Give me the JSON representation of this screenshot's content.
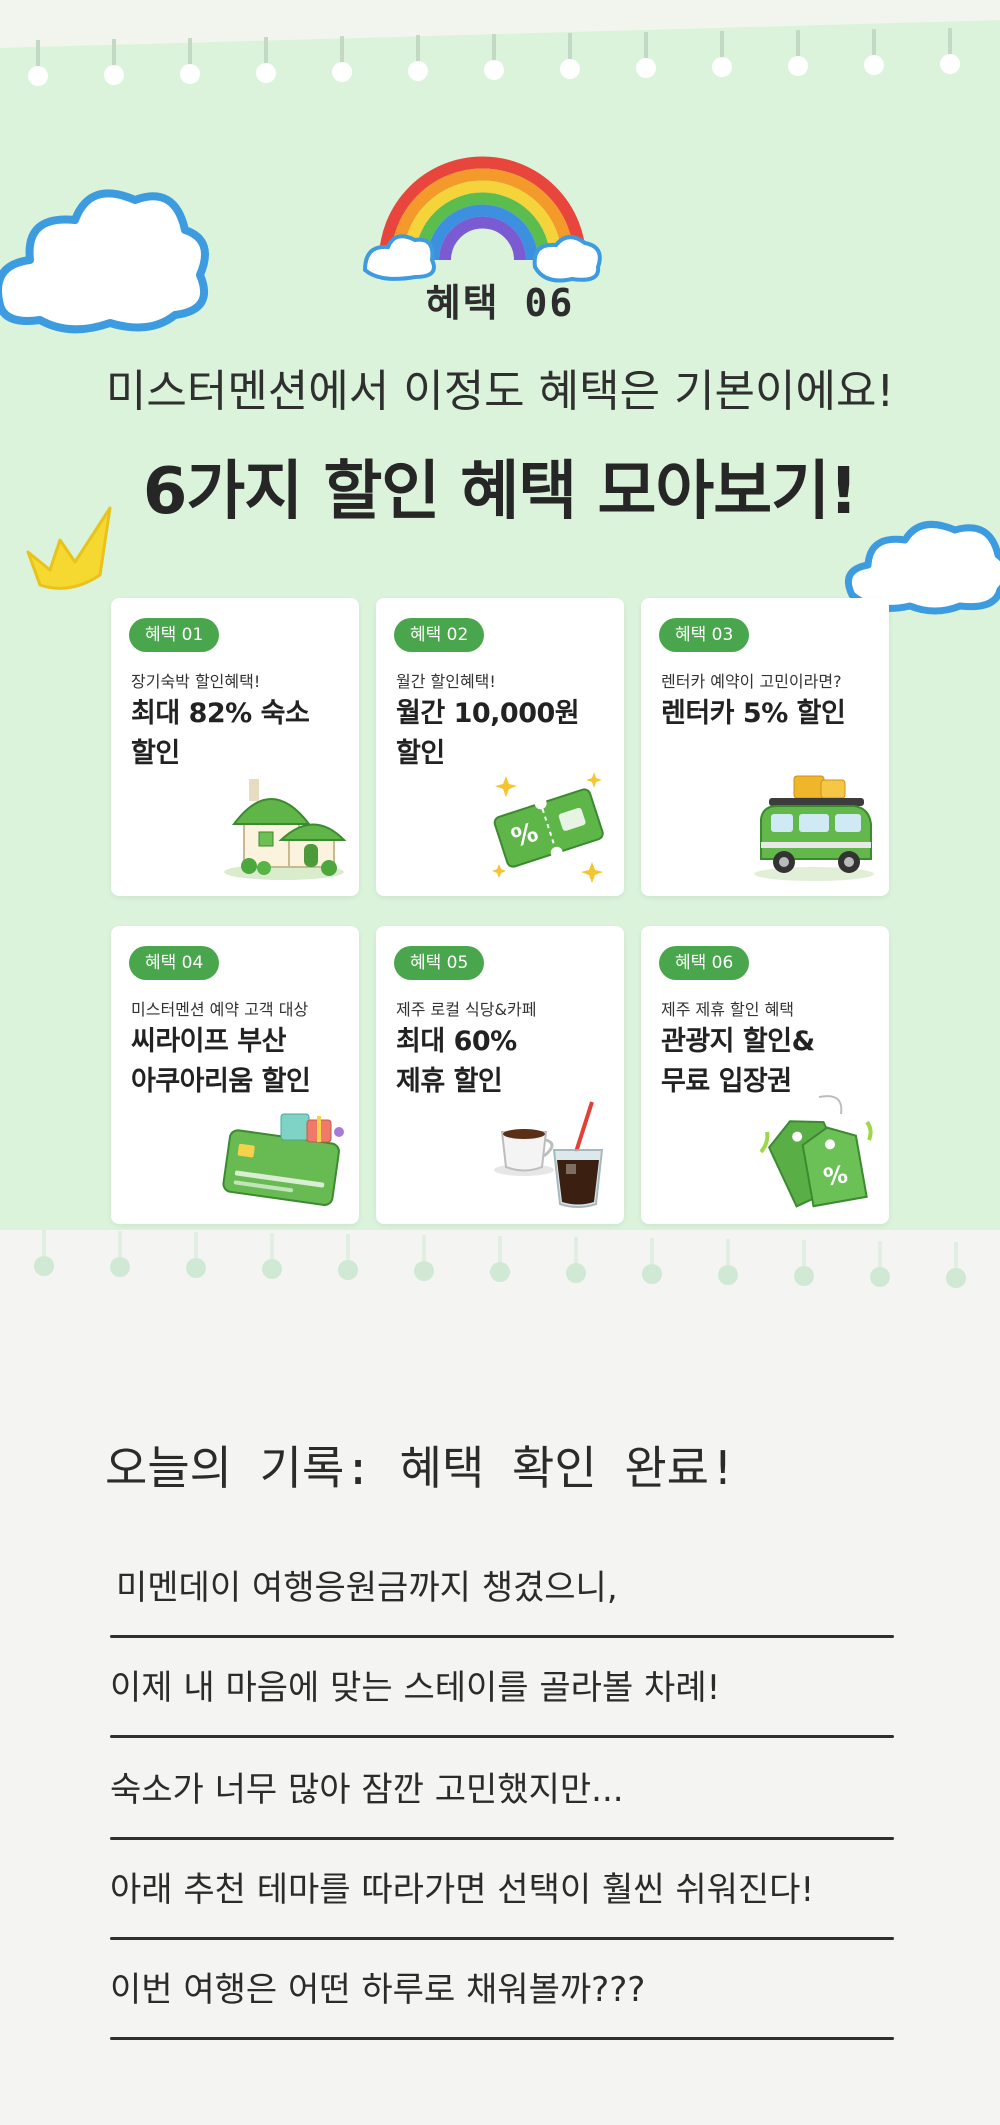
{
  "header": {
    "badge": "혜택 06",
    "subtitle": "미스터멘션에서 이정도 혜택은 기본이에요!",
    "headline": "6가지 할인 혜택 모아보기!"
  },
  "benefits": [
    {
      "tag": "혜택 01",
      "desc": "장기숙박 할인혜택!",
      "title_1": "최대 82% 숙소",
      "title_2": "할인",
      "icon": "house-icon"
    },
    {
      "tag": "혜택 02",
      "desc": "월간 할인혜택!",
      "title_1": "월간 10,000원",
      "title_2": "할인",
      "icon": "coupon-icon"
    },
    {
      "tag": "혜택 03",
      "desc": "렌터카 예약이 고민이라면?",
      "title_1": "렌터카 5% 할인",
      "title_2": "",
      "icon": "car-icon"
    },
    {
      "tag": "혜택 04",
      "desc": "미스터멘션 예약 고객 대상",
      "title_1": "씨라이프 부산",
      "title_2": "아쿠아리움 할인",
      "icon": "card-gift-icon"
    },
    {
      "tag": "혜택 05",
      "desc": "제주 로컬 식당&카페",
      "title_1": "최대 60%",
      "title_2": "제휴 할인",
      "icon": "coffee-icon"
    },
    {
      "tag": "혜택 06",
      "desc": "제주 제휴 할인 혜택",
      "title_1": "관광지 할인&",
      "title_2": "무료 입장권",
      "icon": "price-tag-icon"
    }
  ],
  "journal": {
    "title": "오늘의 기록: 혜택 확인 완료!",
    "lines": [
      "미멘데이 여행응원금까지 챙겼으니,",
      "이제 내 마음에 맞는 스테이를 골라볼 차례!",
      "숙소가 너무 많아 잠깐 고민했지만...",
      "아래 추천 테마를 따라가면 선택이 훨씬 쉬워진다!",
      "이번 여행은 어떤 하루로 채워볼까???"
    ]
  },
  "colors": {
    "top_bg": "#daf3da",
    "tag_green": "#49a64c",
    "bottom_bg": "#f4f4f2"
  }
}
